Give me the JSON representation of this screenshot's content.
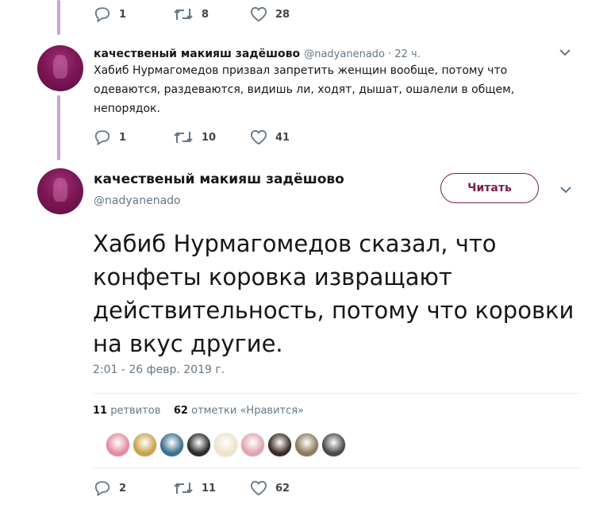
{
  "top_tweet_actions": {
    "reply_count": "1",
    "retweet_count": "8",
    "like_count": "28"
  },
  "reply_tweet": {
    "name": "качественый макияш задёшово",
    "handle": "@nadyanenado",
    "time": " · 22 ч.",
    "text": "Хабиб Нурмагомедов призвал запретить женщин вообще, потому что одеваются, раздеваются, видишь ли, ходят, дышат, ошалели в общем, непорядок.",
    "reply_count": "1",
    "retweet_count": "10",
    "like_count": "41"
  },
  "main_tweet": {
    "name": "качественый макияш задёшово",
    "handle": "@nadyanenado",
    "follow_label": "Читать",
    "text": "Хабиб Нурмагомедов сказал, что конфеты коровка извращают действительность, потому что коровки на вкус другие.",
    "timestamp": "2:01 - 26 февр. 2019 г.",
    "retweets_number": "11",
    "retweets_label": "ретвитов",
    "likes_number": "62",
    "likes_label": "отметки «Нравится»",
    "reply_count": "2",
    "retweet_count": "11",
    "like_count": "62"
  },
  "colors": {
    "accent": "#7a1f4b",
    "thread_line": "#c9a5d4",
    "muted": "#657786"
  },
  "likers": [
    {
      "name": "liker-avatar-1",
      "color": "#e58aa0"
    },
    {
      "name": "liker-avatar-2",
      "color": "#caa24a"
    },
    {
      "name": "liker-avatar-3",
      "color": "#3a6f8f"
    },
    {
      "name": "liker-avatar-4",
      "color": "#2b2b2b"
    },
    {
      "name": "liker-avatar-5",
      "color": "#f0e3c8"
    },
    {
      "name": "liker-avatar-6",
      "color": "#e2a3b0"
    },
    {
      "name": "liker-avatar-7",
      "color": "#3b2a22"
    },
    {
      "name": "liker-avatar-8",
      "color": "#8c7a5a"
    },
    {
      "name": "liker-avatar-9",
      "color": "#4a4a4a"
    }
  ]
}
